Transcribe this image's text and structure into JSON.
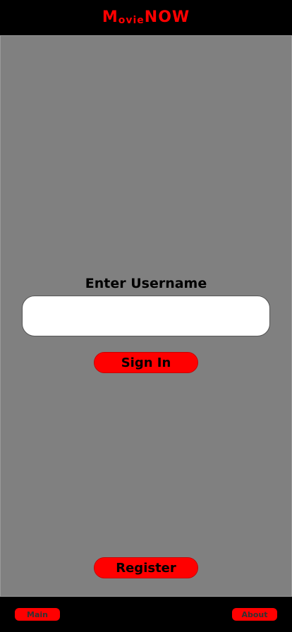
{
  "app": {
    "logo_part1_big": "M",
    "logo_part1_small": "ovie",
    "logo_part2": "NOW"
  },
  "login": {
    "prompt": "Enter Username",
    "username_value": "",
    "username_placeholder": "",
    "signin_label": "Sign In",
    "register_label": "Register"
  },
  "footer": {
    "main_label": "Main",
    "about_label": "About"
  },
  "colors": {
    "accent": "#ff0000",
    "background": "#808080",
    "bar": "#000000"
  }
}
